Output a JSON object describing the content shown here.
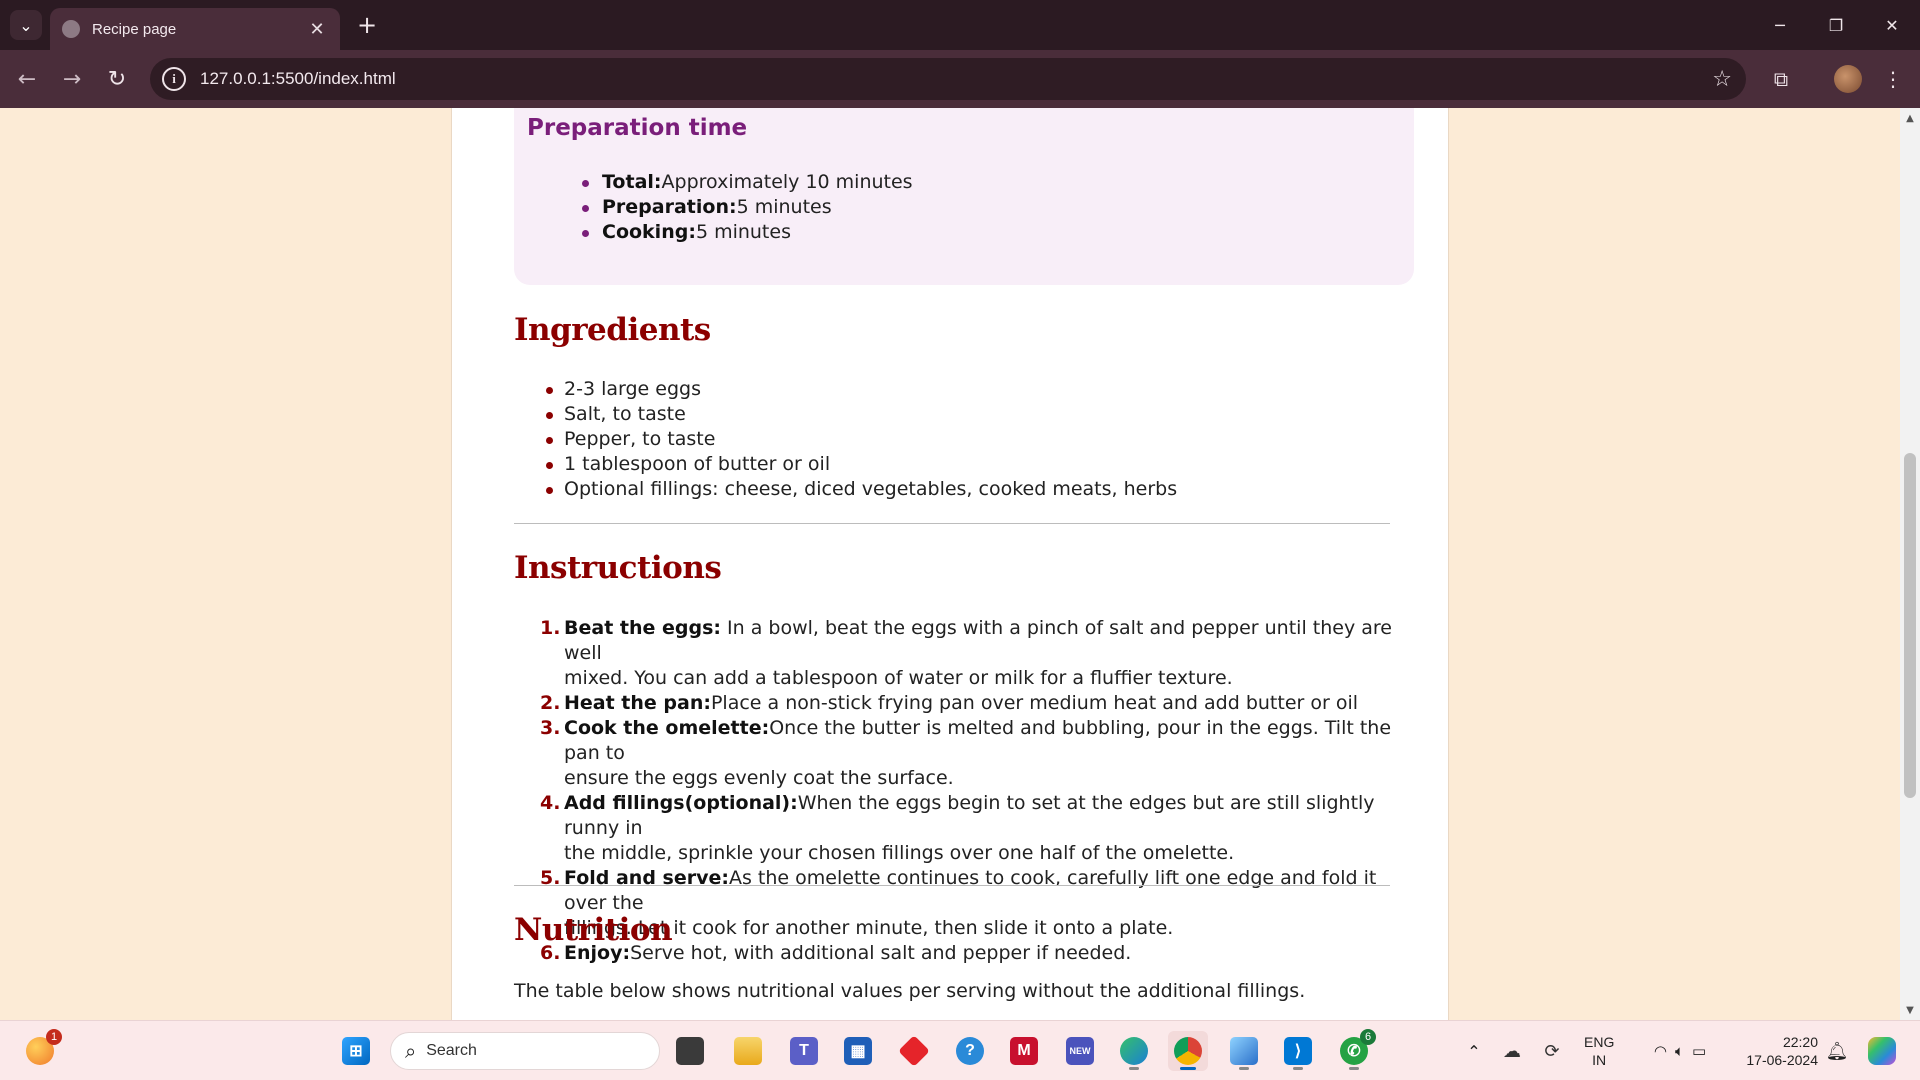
{
  "browser": {
    "tab_title": "Recipe page",
    "url": "127.0.0.1:5500/index.html"
  },
  "prep": {
    "heading": "Preparation time",
    "items": [
      {
        "label": "Total:",
        "value": "Approximately 10 minutes"
      },
      {
        "label": "Preparation:",
        "value": "5 minutes"
      },
      {
        "label": "Cooking:",
        "value": "5 minutes"
      }
    ]
  },
  "ingredients": {
    "heading": "Ingredients",
    "items": [
      "2-3 large eggs",
      "Salt, to taste",
      "Pepper, to taste",
      "1 tablespoon of butter or oil",
      "Optional fillings: cheese, diced vegetables, cooked meats, herbs"
    ]
  },
  "instructions": {
    "heading": "Instructions",
    "items": [
      {
        "num": "1.",
        "label": "Beat the eggs:",
        "line1": " In a bowl, beat the eggs with a pinch of salt and pepper until they are well",
        "line2": "mixed. You can add a tablespoon of water or milk for a fluffier texture."
      },
      {
        "num": "2.",
        "label": "Heat the pan:",
        "line1": "Place a non-stick frying pan over medium heat and add butter or oil",
        "line2": ""
      },
      {
        "num": "3.",
        "label": "Cook the omelette:",
        "line1": "Once the butter is melted and bubbling, pour in the eggs. Tilt the pan to",
        "line2": "ensure the eggs evenly coat the surface."
      },
      {
        "num": "4.",
        "label": "Add fillings(optional):",
        "line1": "When the eggs begin to set at the edges but are still slightly runny in",
        "line2": "the middle, sprinkle your chosen fillings over one half of the omelette."
      },
      {
        "num": "5.",
        "label": "Fold and serve:",
        "line1": "As the omelette continues to cook, carefully lift one edge and fold it over the",
        "line2": "fillings. Let it cook for another minute, then slide it onto a plate."
      },
      {
        "num": "6.",
        "label": "Enjoy:",
        "line1": "Serve hot, with additional salt and pepper if needed.",
        "line2": ""
      }
    ]
  },
  "nutrition": {
    "heading": "Nutrition",
    "text": "The table below shows nutritional values per serving without the additional fillings."
  },
  "taskbar": {
    "search_placeholder": "Search",
    "weather_badge": "1",
    "whatsapp_badge": "6",
    "teams_new": "NEW",
    "lang_line1": "ENG",
    "lang_line2": "IN",
    "time": "22:20",
    "date": "17-06-2024"
  },
  "colors": {
    "page_bg": "#fcebd6",
    "heading_red": "#8b0000",
    "prep_purple": "#7a1e7a",
    "chrome_dark": "#2b1a22",
    "chrome_toolbar": "#4a2d3a"
  }
}
